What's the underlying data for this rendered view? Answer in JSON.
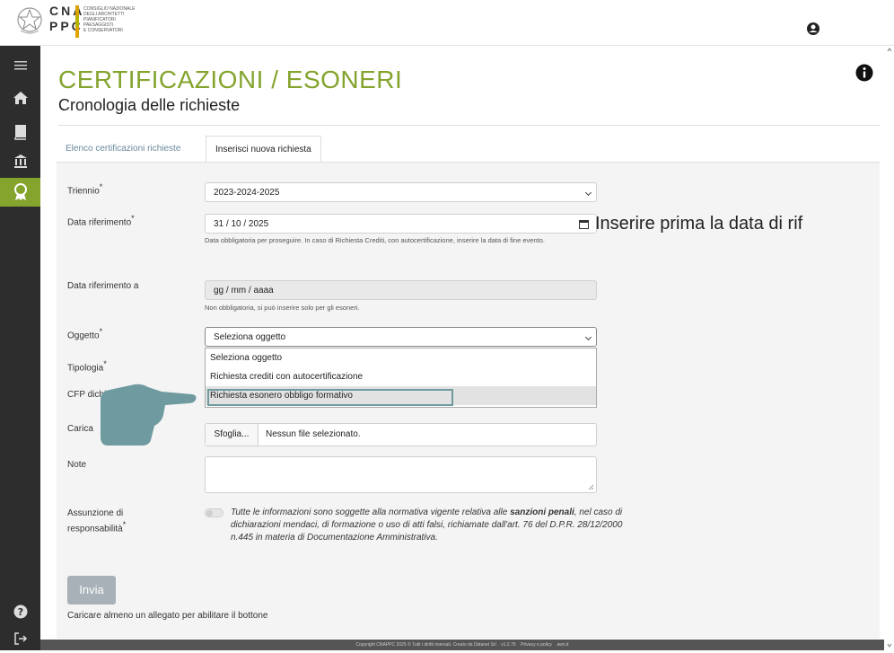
{
  "header": {
    "logo_letters": "CNA\nPPC",
    "logo_lines": [
      "Consiglio Nazionale",
      "degli Architetti",
      "Pianificatori",
      "Paesaggisti",
      "e Conservatori"
    ]
  },
  "sidebar": {
    "items": [
      {
        "icon": "menu-icon"
      },
      {
        "icon": "home-icon"
      },
      {
        "icon": "book-icon"
      },
      {
        "icon": "institution-icon"
      },
      {
        "icon": "award-icon",
        "active": true
      }
    ],
    "bottom_items": [
      {
        "icon": "help-icon"
      },
      {
        "icon": "logout-icon"
      }
    ]
  },
  "page": {
    "title": "CERTIFICAZIONI / ESONERI",
    "subtitle": "Cronologia delle richieste"
  },
  "tabs": [
    {
      "label": "Elenco certificazioni richieste",
      "active": false
    },
    {
      "label": "Inserisci nuova richiesta",
      "active": true
    }
  ],
  "form": {
    "triennio": {
      "label": "Triennio",
      "required": "*",
      "value": "2023-2024-2025"
    },
    "data_riferimento": {
      "label": "Data riferimento",
      "required": "*",
      "value": "31 / 10 / 2025",
      "help": "Data obbligatoria per proseguire. In caso di Richiesta Crediti, con autocertificazione, inserire la data di fine evento."
    },
    "data_riferimento_a": {
      "label": "Data riferimento a",
      "placeholder": "gg / mm / aaaa",
      "help": "Non obbligatoria, si può inserire solo per gli esoneri."
    },
    "oggetto": {
      "label": "Oggetto",
      "required": "*",
      "value": "Seleziona oggetto",
      "options": [
        "Seleziona oggetto",
        "Richiesta crediti con autocertificazione",
        "Richiesta esonero obbligo formativo"
      ]
    },
    "tipologia": {
      "label": "Tipologia",
      "required": "*"
    },
    "cfp": {
      "label": "CFP dichia"
    },
    "carica": {
      "label": "Carica",
      "button": "Sfoglia...",
      "file": "Nessun file selezionato."
    },
    "note": {
      "label": "Note"
    },
    "assunzione": {
      "label_1": "Assunzione di",
      "label_2": "responsabilità",
      "required": "*",
      "text_1": "Tutte le informazioni sono soggette alla normativa vigente relativa alle ",
      "text_bold": "sanzioni penali",
      "text_2": ", nel caso di dichiarazioni mendaci, di formazione o uso di atti falsi, richiamate dall'art. 76 del D.P.R. 28/12/2000 n.445 in materia di Documentazione Amministrativa."
    },
    "submit": "Invia",
    "submit_hint": "Caricare almeno un allegato per abilitare il bottone"
  },
  "annotation_text": "Inserire prima la data di rif",
  "footer": "Copyright CNAPPC 2025 © Tutti i diritti riservati. Creato da Didanet Srl    v1.2.75    Privacy e policy    awn.it",
  "colors": {
    "brand_green": "#84a42e",
    "sidebar": "#2d2d2d",
    "button_disabled": "#a7b1b7"
  }
}
